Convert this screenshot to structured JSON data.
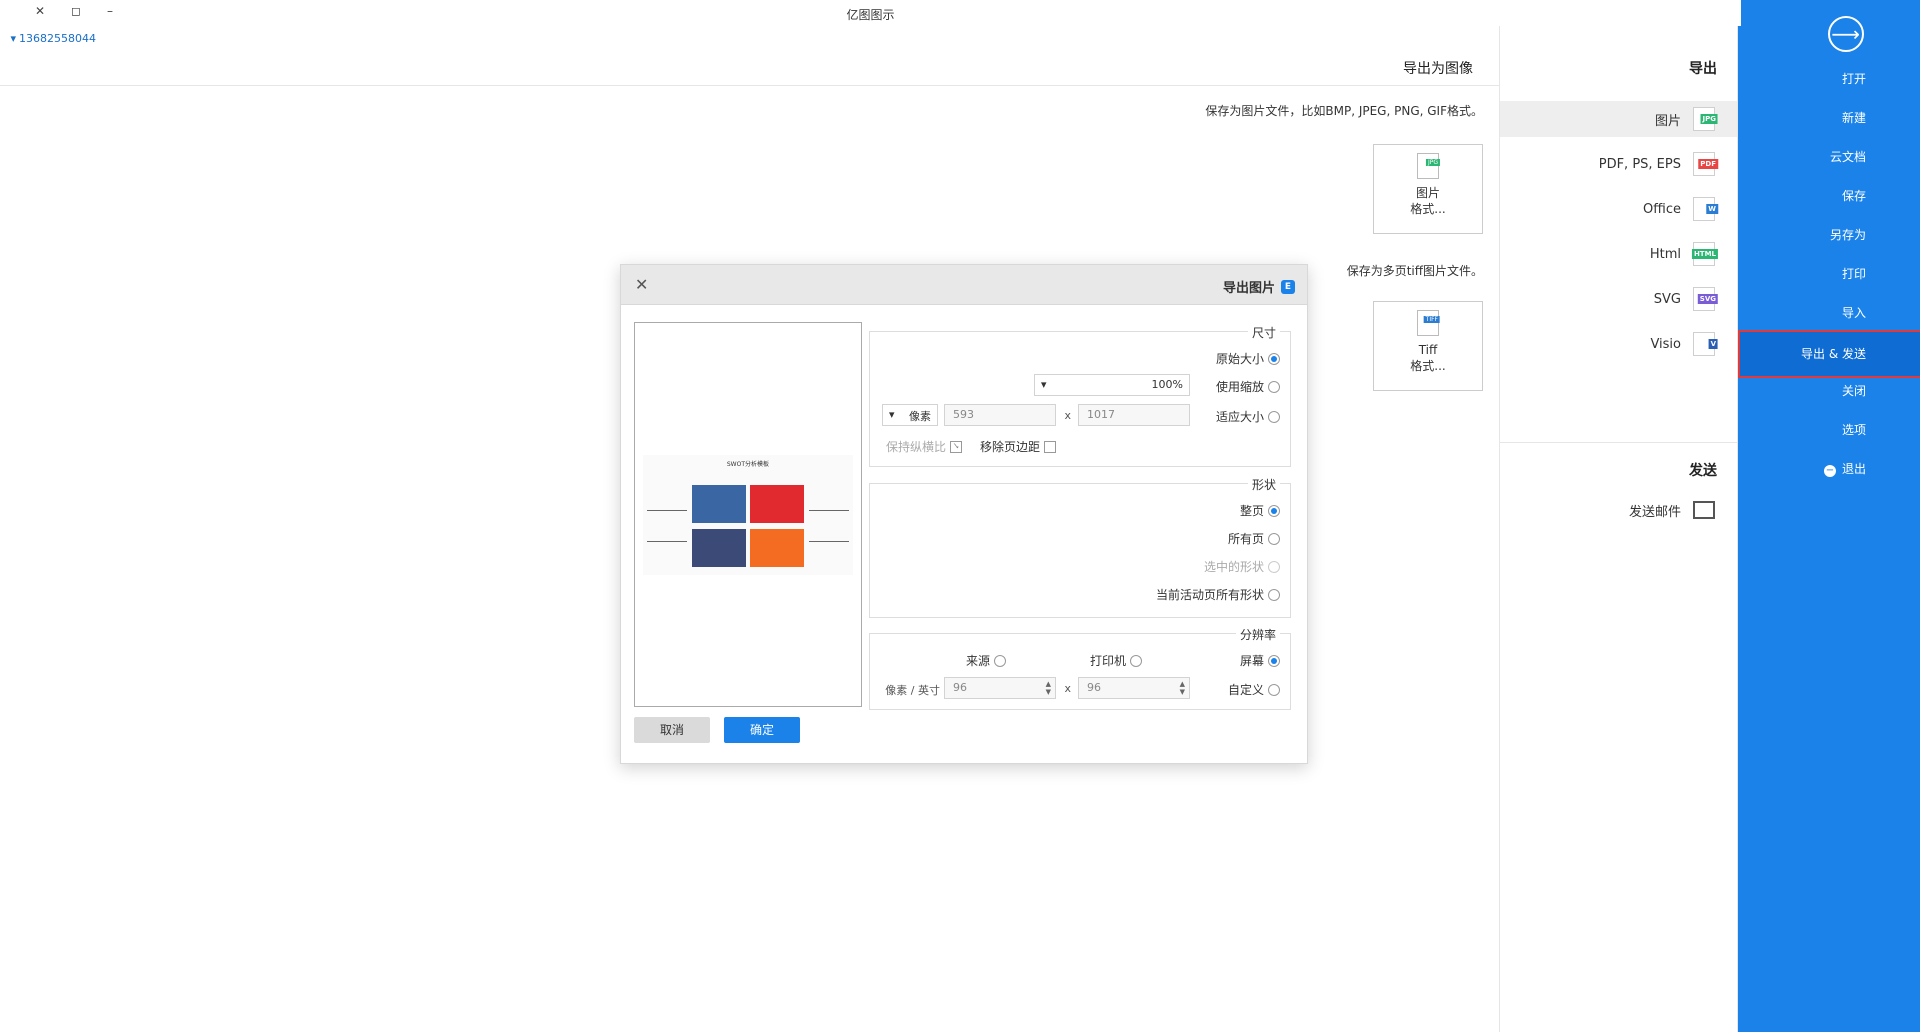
{
  "window": {
    "title": "亿图图示",
    "phone": "13682558044",
    "minimize": "–",
    "restore": "◻",
    "close": "✕"
  },
  "sidebar": {
    "back_icon": "arrow-right-circle-icon",
    "items": [
      {
        "label": "打开"
      },
      {
        "label": "新建"
      },
      {
        "label": "云文档"
      },
      {
        "label": "保存"
      },
      {
        "label": "另存为"
      },
      {
        "label": "打印"
      },
      {
        "label": "导入"
      },
      {
        "label": "导出 & 发送"
      },
      {
        "label": "关闭"
      },
      {
        "label": "选项"
      },
      {
        "label": "退出"
      }
    ]
  },
  "export_column": {
    "heading": "导出",
    "items": [
      {
        "label": "图片",
        "tag": "JPG",
        "color": "#2bb673"
      },
      {
        "label": "PDF, PS, EPS",
        "tag": "PDF",
        "color": "#e84545"
      },
      {
        "label": "Office",
        "tag": "W",
        "color": "#2b7cd3"
      },
      {
        "label": "Html",
        "tag": "HTML",
        "color": "#2bb673"
      },
      {
        "label": "SVG",
        "tag": "SVG",
        "color": "#7a5cd6"
      },
      {
        "label": "Visio",
        "tag": "V",
        "color": "#2b5fb3"
      }
    ],
    "send_heading": "发送",
    "send_item": "发送邮件"
  },
  "content": {
    "title": "导出为图像",
    "desc1": "保存为图片文件，比如BMP, JPEG, PNG, GIF格式。",
    "card1": {
      "line1": "图片",
      "line2": "格式...",
      "tag": "JPG"
    },
    "desc2": "保存为多页tiff图片文件。",
    "card2": {
      "line1": "Tiff",
      "line2": "格式...",
      "tag": "TIFF"
    }
  },
  "dialog": {
    "title": "导出图片",
    "size": {
      "title": "尺寸",
      "original": "原始大小",
      "zoom": "使用缩放",
      "zoom_value": "100%",
      "fit": "适应大小",
      "width": "1017",
      "height": "593",
      "unit": "像素",
      "remove_margin": "移除页边距",
      "keep_ratio": "保持纵横比"
    },
    "shape": {
      "title": "形状",
      "whole_page": "整页",
      "all_pages": "所有页",
      "selected": "选中的形状",
      "current_layer": "当前活动页所有形状"
    },
    "resolution": {
      "title": "分辨率",
      "screen": "屏幕",
      "printer": "打印机",
      "source": "来源",
      "custom": "自定义",
      "dpi_x": "96",
      "dpi_y": "96",
      "unit": "像素 / 英寸"
    },
    "ok": "确定",
    "cancel": "取消",
    "preview_title": "SWOT分析模板"
  }
}
